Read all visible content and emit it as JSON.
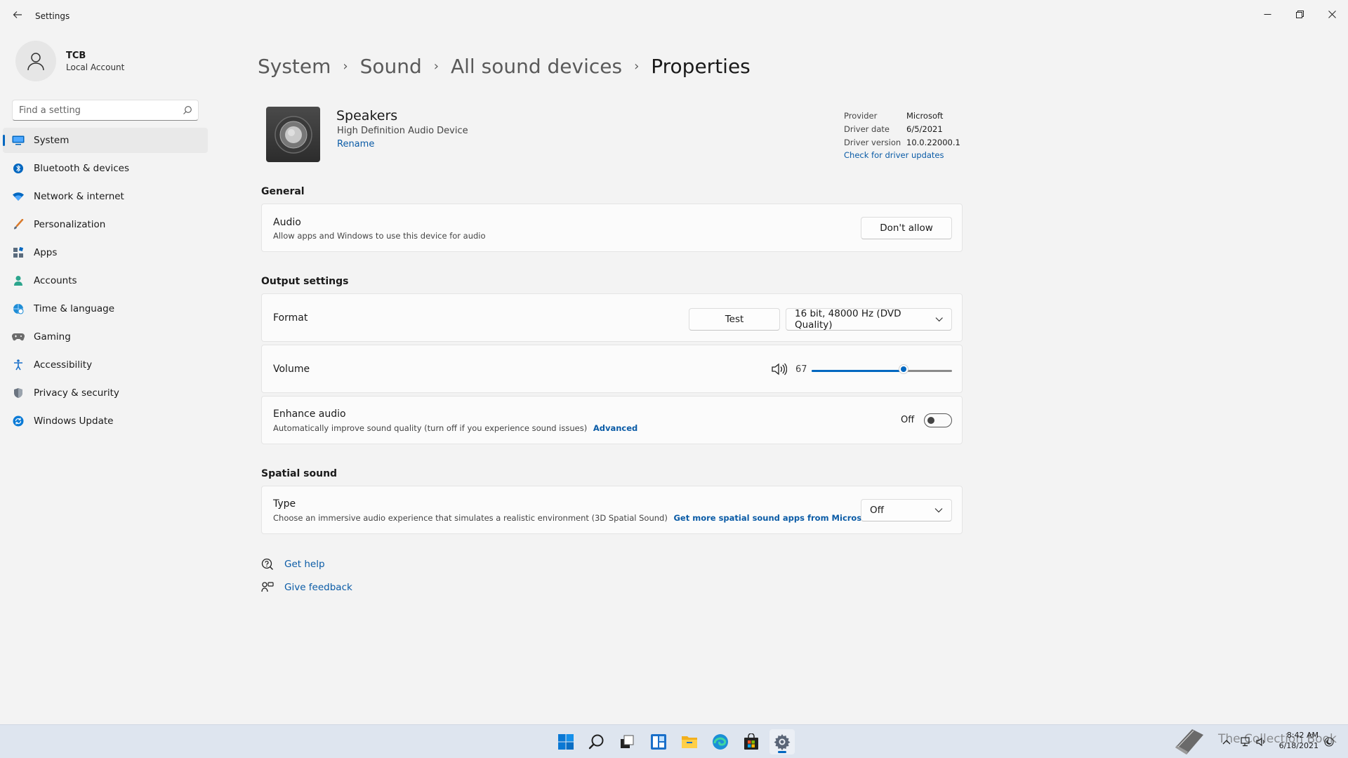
{
  "window": {
    "title": "Settings",
    "back_icon": "back-arrow-icon",
    "minimize_icon": "minimize-icon",
    "maximize_icon": "restore-icon",
    "close_icon": "close-icon"
  },
  "profile": {
    "name": "TCB",
    "account_type": "Local Account"
  },
  "search": {
    "placeholder": "Find a setting"
  },
  "sidebar": {
    "items": [
      {
        "label": "System",
        "icon": "system-icon",
        "active": true,
        "color": "#0067c0"
      },
      {
        "label": "Bluetooth & devices",
        "icon": "bluetooth-icon",
        "color": "#0067c0"
      },
      {
        "label": "Network & internet",
        "icon": "wifi-icon",
        "color": "#0067c0"
      },
      {
        "label": "Personalization",
        "icon": "brush-icon",
        "color": "#d97a2b"
      },
      {
        "label": "Apps",
        "icon": "apps-icon",
        "color": "#5a6b7d"
      },
      {
        "label": "Accounts",
        "icon": "person-icon",
        "color": "#2ca58d"
      },
      {
        "label": "Time & language",
        "icon": "globe-clock-icon",
        "color": "#1f8dd6"
      },
      {
        "label": "Gaming",
        "icon": "controller-icon",
        "color": "#6b6b6b"
      },
      {
        "label": "Accessibility",
        "icon": "accessibility-icon",
        "color": "#1a6fc9"
      },
      {
        "label": "Privacy & security",
        "icon": "shield-icon",
        "color": "#6b7480"
      },
      {
        "label": "Windows Update",
        "icon": "update-icon",
        "color": "#0a7ad6"
      }
    ]
  },
  "breadcrumb": {
    "items": [
      "System",
      "Sound",
      "All sound devices",
      "Properties"
    ]
  },
  "device": {
    "name": "Speakers",
    "description": "High Definition Audio Device",
    "rename_label": "Rename",
    "driver": {
      "provider_label": "Provider",
      "provider": "Microsoft",
      "date_label": "Driver date",
      "date": "6/5/2021",
      "version_label": "Driver version",
      "version": "10.0.22000.1",
      "update_link": "Check for driver updates"
    }
  },
  "general": {
    "title": "General",
    "audio": {
      "title": "Audio",
      "subtitle": "Allow apps and Windows to use this device for audio",
      "button": "Don't allow"
    }
  },
  "output": {
    "title": "Output settings",
    "format": {
      "title": "Format",
      "test_button": "Test",
      "selected": "16 bit, 48000 Hz (DVD Quality)"
    },
    "volume": {
      "title": "Volume",
      "value": 67,
      "value_text": "67",
      "level_fraction": 0.655
    },
    "enhance": {
      "title": "Enhance audio",
      "subtitle": "Automatically improve sound quality (turn off if you experience sound issues)",
      "link": "Advanced",
      "state": "Off"
    }
  },
  "spatial": {
    "title": "Spatial sound",
    "type": {
      "title": "Type",
      "subtitle": "Choose an immersive audio experience that simulates a realistic environment (3D Spatial Sound)",
      "link": "Get more spatial sound apps from Microsoft Store",
      "selected": "Off"
    }
  },
  "help": {
    "get_help": "Get help",
    "give_feedback": "Give feedback"
  },
  "taskbar": {
    "apps": [
      "start-icon",
      "search-icon",
      "task-view-icon",
      "widgets-icon",
      "file-explorer-icon",
      "edge-icon",
      "store-icon",
      "settings-icon"
    ],
    "watermark": "The Collection Book",
    "time": "8:42 AM",
    "date": "6/18/2021"
  },
  "colors": {
    "accent": "#0067c0",
    "link": "#0a5ba6",
    "background": "#f3f3f3"
  }
}
